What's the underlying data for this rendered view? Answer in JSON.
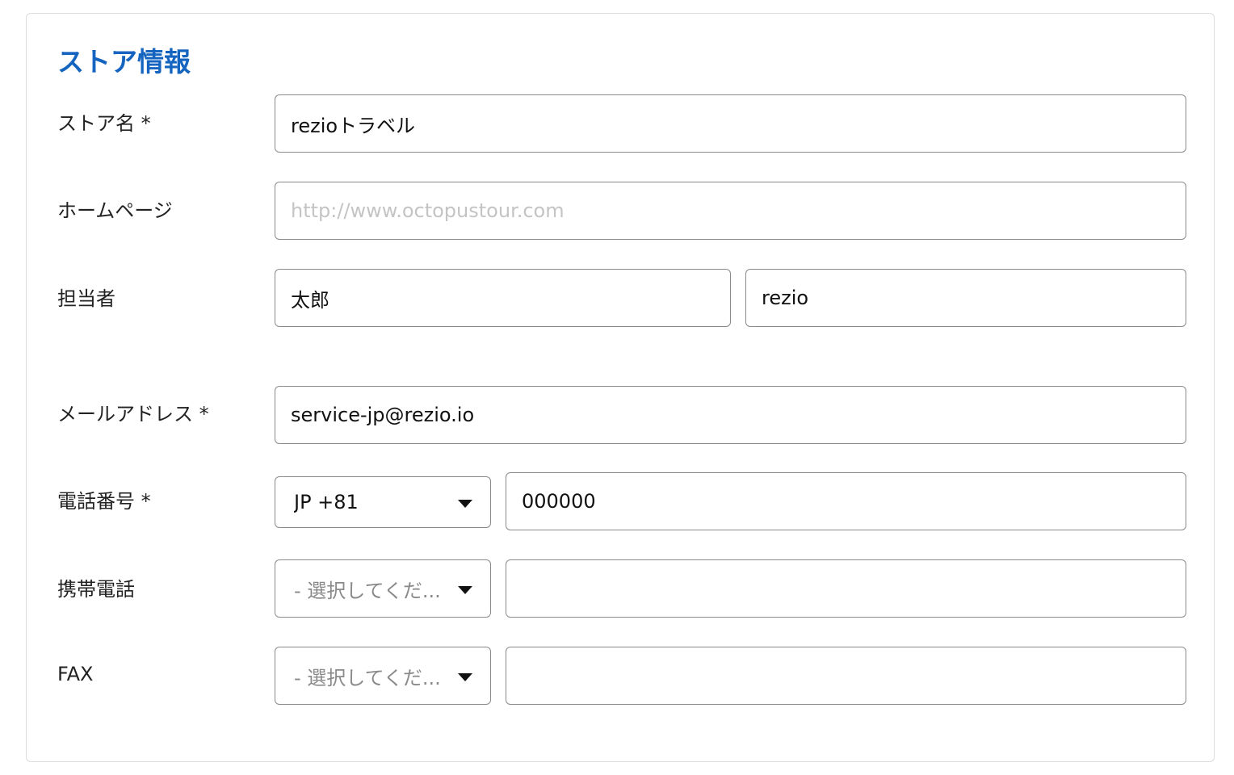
{
  "section": {
    "title": "ストア情報"
  },
  "store_name": {
    "label": "ストア名 *",
    "value": "rezioトラベル"
  },
  "homepage": {
    "label": "ホームページ",
    "value": "",
    "placeholder": "http://www.octopustour.com"
  },
  "contact_person": {
    "label": "担当者",
    "first_name": "太郎",
    "last_name": "rezio"
  },
  "email": {
    "label": "メールアドレス *",
    "value": "service-jp@rezio.io"
  },
  "phone": {
    "label": "電話番号 *",
    "country_code": "JP +81",
    "value": "000000"
  },
  "mobile": {
    "label": "携帯電話",
    "country_code": "- 選択してくだ...",
    "value": ""
  },
  "fax": {
    "label": "FAX",
    "country_code": "- 選択してくだ...",
    "value": ""
  },
  "colors": {
    "accent": "#1565c0",
    "border": "#8a8a8a",
    "card_border": "#dcdcdc"
  },
  "icons": {
    "select_caret": "caret-down-icon"
  }
}
